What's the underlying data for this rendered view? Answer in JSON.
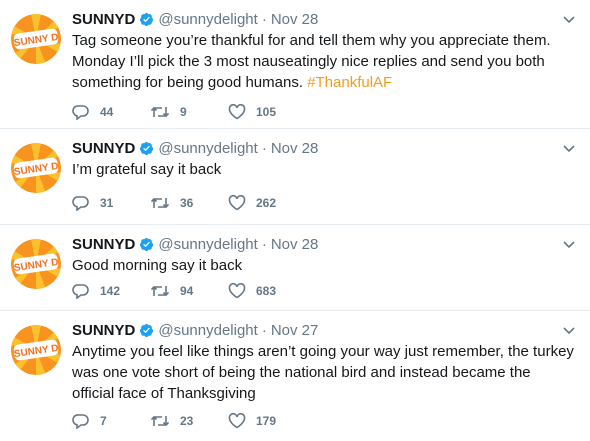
{
  "account": {
    "name": "SUNNYD",
    "handle": "@sunnydelight",
    "avatar_text": "SUNNY D",
    "avatar_colors": {
      "ray_orange": "#f7931e",
      "ray_light": "#fbc02d",
      "badge": "#ffffff",
      "text": "#f37021"
    },
    "verified_color": "#1da1f2"
  },
  "colors": {
    "hashtag": "#f39c1f",
    "muted": "#657786",
    "divider": "#e6ecf0"
  },
  "tweets": [
    {
      "date": "Nov 28",
      "text": "Tag someone you’re thankful for and tell them why you appreciate them. Monday I’ll pick the 3 most nauseatingly nice replies and send you both something for being good humans. ",
      "hashtag": "#ThankfulAF",
      "replies": "44",
      "retweets": "9",
      "likes": "105"
    },
    {
      "date": "Nov 28",
      "text": "I’m grateful say it back",
      "hashtag": "",
      "replies": "31",
      "retweets": "36",
      "likes": "262"
    },
    {
      "date": "Nov 28",
      "text": "Good morning say it back",
      "hashtag": "",
      "replies": "142",
      "retweets": "94",
      "likes": "683"
    },
    {
      "date": "Nov 27",
      "text": "Anytime you feel like things aren’t going your way just remember, the turkey was one vote short of being the national bird and instead became the official face of Thanksgiving",
      "hashtag": "",
      "replies": "7",
      "retweets": "23",
      "likes": "179"
    }
  ],
  "icons": {
    "reply": "reply-icon",
    "retweet": "retweet-icon",
    "like": "heart-icon",
    "verified": "verified-badge-icon",
    "menu": "chevron-down-icon"
  }
}
